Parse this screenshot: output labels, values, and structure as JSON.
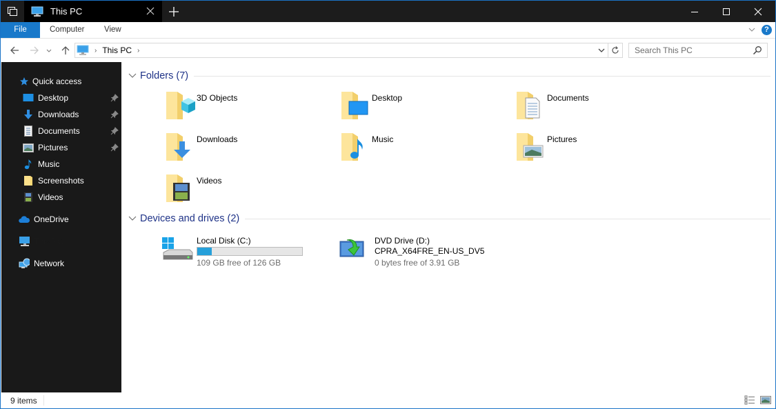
{
  "window": {
    "tab_title": "This PC",
    "controls": {
      "minimize": "minimize-icon",
      "maximize": "maximize-icon",
      "close": "close-icon"
    }
  },
  "ribbon": {
    "tabs": [
      {
        "label": "File",
        "active": true
      },
      {
        "label": "Computer"
      },
      {
        "label": "View"
      }
    ],
    "accent": "#1979ca"
  },
  "nav": {
    "breadcrumb": [
      "This PC"
    ],
    "search_placeholder": "Search This PC"
  },
  "sidebar": {
    "quick_access": "Quick access",
    "items": [
      {
        "label": "Desktop",
        "pinned": true,
        "icon": "desktop-icon"
      },
      {
        "label": "Downloads",
        "pinned": true,
        "icon": "download-icon"
      },
      {
        "label": "Documents",
        "pinned": true,
        "icon": "document-icon"
      },
      {
        "label": "Pictures",
        "pinned": true,
        "icon": "picture-icon"
      },
      {
        "label": "Music",
        "pinned": false,
        "icon": "music-icon"
      },
      {
        "label": "Screenshots",
        "pinned": false,
        "icon": "folder-icon"
      },
      {
        "label": "Videos",
        "pinned": false,
        "icon": "video-icon"
      }
    ],
    "onedrive": "OneDrive",
    "this_pc": "This PC",
    "network": "Network"
  },
  "folders": {
    "title": "Folders (7)",
    "items": [
      {
        "label": "3D Objects",
        "icon": "cube-icon"
      },
      {
        "label": "Desktop",
        "icon": "desktop-icon"
      },
      {
        "label": "Documents",
        "icon": "document-icon"
      },
      {
        "label": "Downloads",
        "icon": "download-icon"
      },
      {
        "label": "Music",
        "icon": "music-icon"
      },
      {
        "label": "Pictures",
        "icon": "picture-icon"
      },
      {
        "label": "Videos",
        "icon": "video-icon"
      }
    ]
  },
  "drives": {
    "title": "Devices and drives (2)",
    "items": [
      {
        "name": "Local Disk (C:)",
        "free_text": "109 GB free of 126 GB",
        "used_fraction": 0.135
      },
      {
        "name": "DVD Drive (D:)",
        "label": "CPRA_X64FRE_EN-US_DV5",
        "free_text": "0 bytes free of 3.91 GB"
      }
    ]
  },
  "status": {
    "count": "9 items"
  }
}
